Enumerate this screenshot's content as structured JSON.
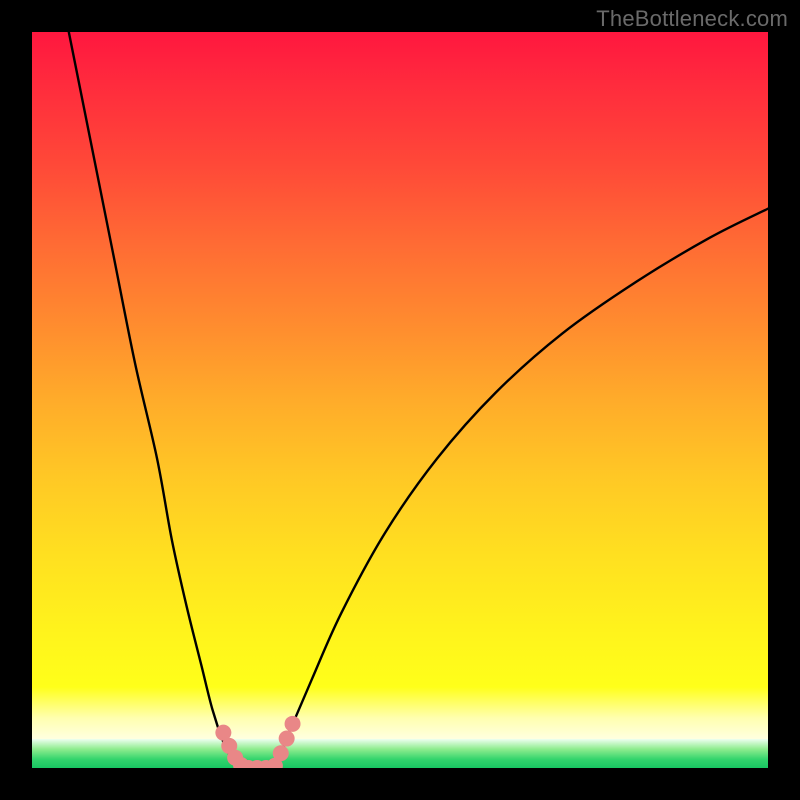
{
  "watermark": "TheBottleneck.com",
  "chart_data": {
    "type": "line",
    "title": "",
    "xlabel": "",
    "ylabel": "",
    "xlim": [
      0,
      100
    ],
    "ylim": [
      0,
      100
    ],
    "grid": false,
    "legend": false,
    "background": {
      "type": "vertical-gradient",
      "stops": [
        {
          "pct": 0,
          "color": "#ff173f"
        },
        {
          "pct": 50,
          "color": "#ffab2a"
        },
        {
          "pct": 85,
          "color": "#ffff1a"
        },
        {
          "pct": 93,
          "color": "#ffffe0"
        },
        {
          "pct": 100,
          "color": "#18c663"
        }
      ]
    },
    "series": [
      {
        "name": "left-branch",
        "x": [
          5.0,
          8.0,
          11.0,
          14.0,
          17.0,
          19.0,
          21.0,
          23.0,
          24.5,
          26.0,
          27.0,
          28.0
        ],
        "y": [
          100.0,
          85.0,
          70.0,
          55.0,
          42.0,
          31.0,
          22.0,
          14.0,
          8.0,
          3.5,
          1.5,
          0.0
        ]
      },
      {
        "name": "valley-floor",
        "x": [
          28.0,
          29.0,
          30.0,
          31.0,
          32.0,
          33.0
        ],
        "y": [
          0.0,
          0.0,
          0.0,
          0.0,
          0.0,
          0.0
        ]
      },
      {
        "name": "right-branch",
        "x": [
          33.0,
          35.0,
          38.0,
          42.0,
          48.0,
          55.0,
          63.0,
          72.0,
          82.0,
          92.0,
          100.0
        ],
        "y": [
          0.0,
          5.0,
          12.0,
          21.0,
          32.0,
          42.0,
          51.0,
          59.0,
          66.0,
          72.0,
          76.0
        ]
      }
    ],
    "highlight_points": {
      "name": "valley-markers",
      "color": "#e98787",
      "points": [
        {
          "x": 26.0,
          "y": 4.8
        },
        {
          "x": 26.8,
          "y": 3.0
        },
        {
          "x": 27.6,
          "y": 1.4
        },
        {
          "x": 28.4,
          "y": 0.4
        },
        {
          "x": 29.4,
          "y": 0.0
        },
        {
          "x": 30.6,
          "y": 0.0
        },
        {
          "x": 31.8,
          "y": 0.0
        },
        {
          "x": 33.0,
          "y": 0.3
        },
        {
          "x": 33.8,
          "y": 2.0
        },
        {
          "x": 34.6,
          "y": 4.0
        },
        {
          "x": 35.4,
          "y": 6.0
        }
      ]
    }
  }
}
